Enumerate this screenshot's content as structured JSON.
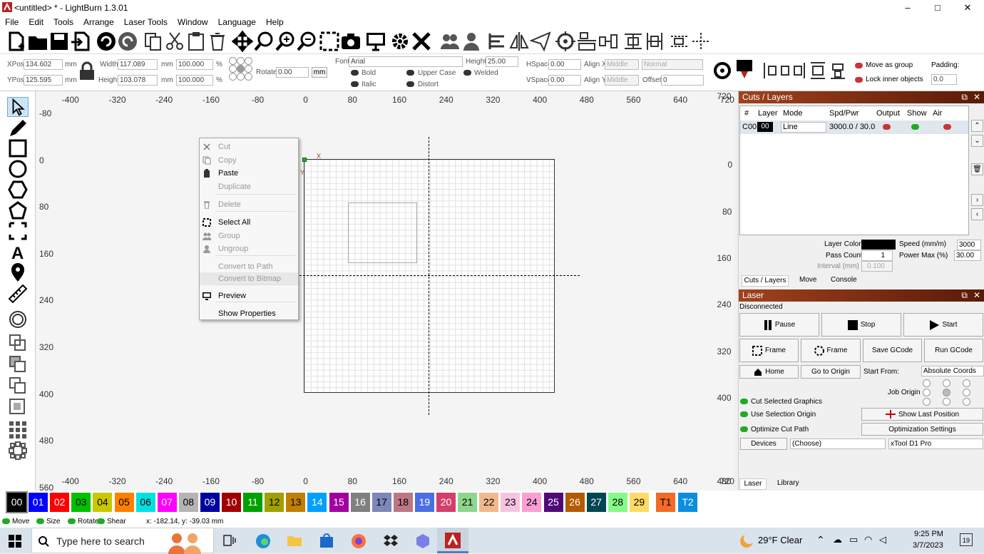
{
  "window": {
    "title": "<untitled> * - LightBurn 1.3.01",
    "minimize": "–",
    "maximize": "□",
    "close": "✕"
  },
  "menu": [
    "File",
    "Edit",
    "Tools",
    "Arrange",
    "Laser Tools",
    "Window",
    "Language",
    "Help"
  ],
  "props": {
    "xpos_label": "XPos",
    "xpos": "134.602",
    "ypos_label": "YPos",
    "ypos": "125.595",
    "unit": "mm",
    "width_label": "Width",
    "width": "117.089",
    "height_label": "Height",
    "height": "103.078",
    "wpct": "100.000",
    "hpct": "100.000",
    "pct": "%",
    "rotate_label": "Rotate",
    "rotate": "0.00",
    "mm_btn": "mm",
    "font_label": "Font",
    "font": "Arial",
    "fheight_label": "Height",
    "fheight": "25.00",
    "bold": "Bold",
    "italic": "Italic",
    "upper": "Upper Case",
    "distort": "Distort",
    "welded": "Welded",
    "hspace_label": "HSpace",
    "hspace": "0.00",
    "vspace_label": "VSpace",
    "vspace": "0.00",
    "alignx_label": "Align X",
    "alignx": "Middle",
    "aligny_label": "Align Y",
    "aligny": "Middle",
    "normal": "Normal",
    "offset_label": "Offset",
    "offset": "0",
    "move_group": "Move as group",
    "lock_inner": "Lock inner objects",
    "padding_label": "Padding:",
    "padding": "0.0"
  },
  "ruler": {
    "top": [
      "-400",
      "-320",
      "-240",
      "-160",
      "-80",
      "0",
      "80",
      "160",
      "240",
      "320",
      "400",
      "480",
      "560",
      "640",
      "720"
    ],
    "left": [
      "-80",
      "0",
      "80",
      "160",
      "240",
      "320",
      "400",
      "480",
      "560"
    ],
    "right": [
      "0",
      "80",
      "160",
      "240",
      "320",
      "400",
      "480",
      "720"
    ]
  },
  "context_menu": [
    {
      "label": "Cut",
      "enabled": false,
      "icon": "scissors-icon"
    },
    {
      "label": "Copy",
      "enabled": false,
      "icon": "copy-icon"
    },
    {
      "label": "Paste",
      "enabled": true,
      "icon": "paste-icon"
    },
    {
      "label": "Duplicate",
      "enabled": false,
      "icon": ""
    },
    {
      "label": "Delete",
      "enabled": false,
      "icon": "trash-icon"
    },
    {
      "label": "Select All",
      "enabled": true,
      "icon": "select-all-icon"
    },
    {
      "label": "Group",
      "enabled": false,
      "icon": "group-icon"
    },
    {
      "label": "Ungroup",
      "enabled": false,
      "icon": "ungroup-icon"
    },
    {
      "label": "Convert to Path",
      "enabled": false,
      "icon": ""
    },
    {
      "label": "Convert to Bitmap",
      "enabled": false,
      "icon": ""
    },
    {
      "label": "Preview",
      "enabled": true,
      "icon": "monitor-icon"
    },
    {
      "label": "Show Properties",
      "enabled": true,
      "icon": ""
    }
  ],
  "cuts": {
    "title": "Cuts / Layers",
    "cols": [
      "#",
      "Layer",
      "Mode",
      "Spd/Pwr",
      "Output",
      "Show",
      "Air"
    ],
    "row": {
      "num": "C00",
      "layer": "00",
      "mode": "Line",
      "spdpwr": "3000.0 / 30.0"
    },
    "layer_color": "Layer Color",
    "speed_label": "Speed (mm/m)",
    "speed": "3000",
    "pass_label": "Pass Count",
    "pass": "1",
    "power_label": "Power Max (%)",
    "power": "30.00",
    "interval_label": "Interval (mm)",
    "interval": "0.100",
    "tabs": [
      "Cuts / Layers",
      "Move",
      "Console"
    ]
  },
  "laser": {
    "title": "Laser",
    "status": "Disconnected",
    "pause": "Pause",
    "stop": "Stop",
    "start": "Start",
    "frame1": "Frame",
    "frame2": "Frame",
    "save_gcode": "Save GCode",
    "run_gcode": "Run GCode",
    "home": "Home",
    "go_origin": "Go to Origin",
    "start_from_label": "Start From:",
    "start_from": "Absolute Coords",
    "job_origin": "Job Origin",
    "cut_selected": "Cut Selected Graphics",
    "use_sel_origin": "Use Selection Origin",
    "optimize": "Optimize Cut Path",
    "show_last": "Show Last Position",
    "opt_settings": "Optimization Settings",
    "devices": "Devices",
    "choose": "(Choose)",
    "device": "xTool D1 Pro",
    "tabs": [
      "Laser",
      "Library"
    ]
  },
  "palette": [
    {
      "l": "00",
      "c": "#000000",
      "t": "#fff"
    },
    {
      "l": "01",
      "c": "#0000ff",
      "t": "#fff"
    },
    {
      "l": "02",
      "c": "#ff0000",
      "t": "#fff"
    },
    {
      "l": "03",
      "c": "#00c000",
      "t": "#000"
    },
    {
      "l": "04",
      "c": "#c8c800",
      "t": "#000"
    },
    {
      "l": "05",
      "c": "#ff8000",
      "t": "#000"
    },
    {
      "l": "06",
      "c": "#00e0e0",
      "t": "#000"
    },
    {
      "l": "07",
      "c": "#ff00ff",
      "t": "#fff"
    },
    {
      "l": "08",
      "c": "#b4b4b4",
      "t": "#000"
    },
    {
      "l": "09",
      "c": "#0000a0",
      "t": "#fff"
    },
    {
      "l": "10",
      "c": "#a00000",
      "t": "#fff"
    },
    {
      "l": "11",
      "c": "#00a000",
      "t": "#fff"
    },
    {
      "l": "12",
      "c": "#a0a000",
      "t": "#000"
    },
    {
      "l": "13",
      "c": "#c08000",
      "t": "#000"
    },
    {
      "l": "14",
      "c": "#00a0ff",
      "t": "#fff"
    },
    {
      "l": "15",
      "c": "#a000a0",
      "t": "#fff"
    },
    {
      "l": "16",
      "c": "#808080",
      "t": "#fff"
    },
    {
      "l": "17",
      "c": "#7d87b9",
      "t": "#000"
    },
    {
      "l": "18",
      "c": "#bb7784",
      "t": "#000"
    },
    {
      "l": "19",
      "c": "#4a6fe3",
      "t": "#fff"
    },
    {
      "l": "20",
      "c": "#d33f6a",
      "t": "#fff"
    },
    {
      "l": "21",
      "c": "#8cd78c",
      "t": "#000"
    },
    {
      "l": "22",
      "c": "#f0b98d",
      "t": "#000"
    },
    {
      "l": "23",
      "c": "#f6c4e1",
      "t": "#000"
    },
    {
      "l": "24",
      "c": "#fa9ed4",
      "t": "#000"
    },
    {
      "l": "25",
      "c": "#500a78",
      "t": "#fff"
    },
    {
      "l": "26",
      "c": "#b45a00",
      "t": "#fff"
    },
    {
      "l": "27",
      "c": "#004754",
      "t": "#fff"
    },
    {
      "l": "28",
      "c": "#86fa88",
      "t": "#000"
    },
    {
      "l": "29",
      "c": "#ffdb66",
      "t": "#000"
    },
    {
      "l": "T1",
      "c": "#f36926",
      "t": "#000"
    },
    {
      "l": "T2",
      "c": "#0c8edf",
      "t": "#fff"
    }
  ],
  "status": {
    "move": "Move",
    "size": "Size",
    "rotate": "Rotate",
    "shear": "Shear",
    "coords": "x: -182.14, y: -39.03 mm"
  },
  "taskbar": {
    "search": "Type here to search",
    "weather": "29°F  Clear",
    "time": "9:25 PM",
    "date": "3/7/2023",
    "notif": "19"
  }
}
